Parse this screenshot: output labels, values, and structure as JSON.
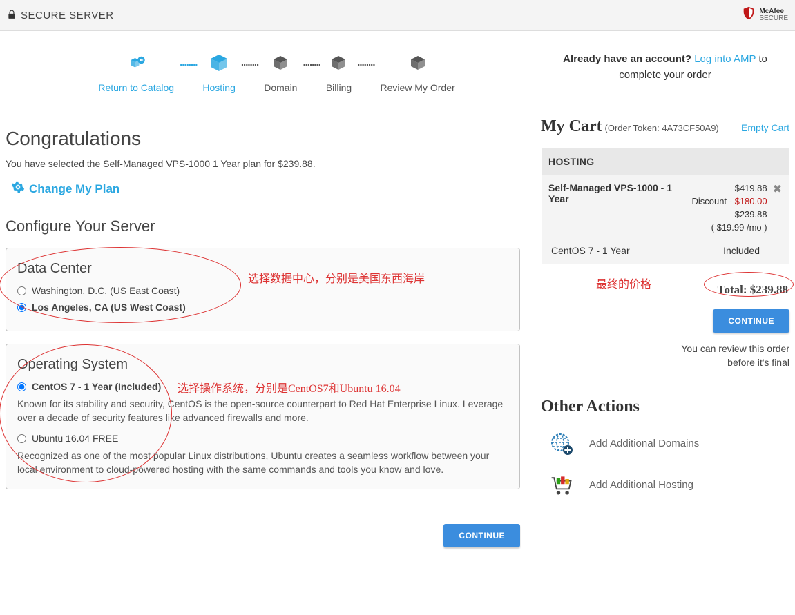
{
  "topbar": {
    "secure_label": "SECURE SERVER",
    "badge_brand": "McAfee",
    "badge_sub": "SECURE"
  },
  "steps": {
    "return": "Return to Catalog",
    "hosting": "Hosting",
    "domain": "Domain",
    "billing": "Billing",
    "review": "Review My Order"
  },
  "main": {
    "congrats": "Congratulations",
    "subline": "You have selected the Self-Managed VPS-1000 1 Year plan for $239.88.",
    "change_plan": "Change My Plan",
    "configure": "Configure Your Server",
    "continue": "CONTINUE"
  },
  "datacenter": {
    "title": "Data Center",
    "opt1": "Washington, D.C. (US East Coast)",
    "opt2": "Los Angeles, CA (US West Coast)",
    "annotation": "选择数据中心，分别是美国东西海岸"
  },
  "os": {
    "title": "Operating System",
    "opt1": "CentOS 7 - 1 Year (Included)",
    "desc1": "Known for its stability and security, CentOS is the open-source counterpart to Red Hat Enterprise Linux. Leverage over a decade of security features like advanced firewalls and more.",
    "opt2": "Ubuntu 16.04 FREE",
    "desc2": "Recognized as one of the most popular Linux distributions, Ubuntu creates a seamless workflow between your local environment to cloud-powered hosting with the same commands and tools you know and love.",
    "annotation": "选择操作系统，分别是CentOS7和Ubuntu 16.04"
  },
  "side": {
    "amp_prefix": "Already have an account? ",
    "amp_link": "Log into AMP",
    "amp_suffix": " to complete your order",
    "cart_title": "My Cart",
    "token_label": "(Order Token: 4A73CF50A9)",
    "empty_cart": "Empty Cart",
    "hosting_head": "HOSTING",
    "item_name": "Self-Managed VPS-1000 - 1 Year",
    "price_orig": "$419.88",
    "discount_label": "Discount - ",
    "discount_amount": "$180.00",
    "price_disc": "$239.88",
    "price_monthly": "( $19.99 /mo )",
    "subitem_name": "CentOS 7 - 1 Year",
    "subitem_price": "Included",
    "total_label": "Total: $239.88",
    "price_annotation": "最终的价格",
    "continue": "CONTINUE",
    "review_note1": "You can review this order",
    "review_note2": "before it's final",
    "other_actions": "Other Actions",
    "add_domains": "Add Additional Domains",
    "add_hosting": "Add Additional Hosting"
  }
}
